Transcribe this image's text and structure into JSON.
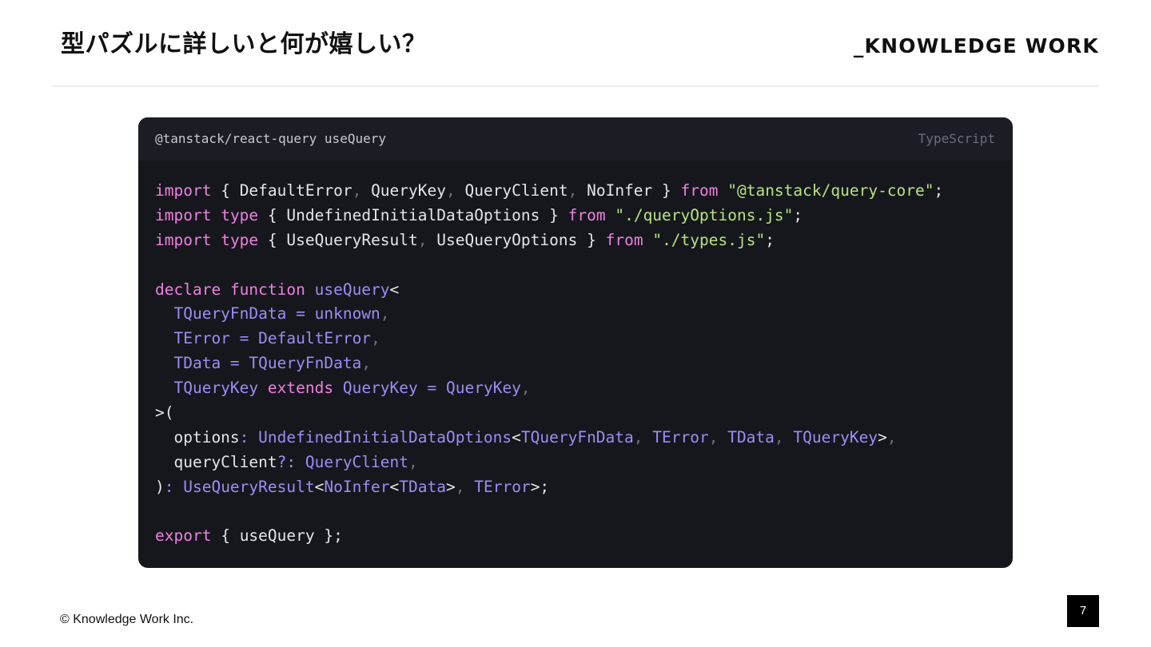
{
  "slide": {
    "title": "型パズルに詳しいと何が嬉しい？",
    "brand": "_KNOWLEDGE WORK",
    "copyright": "© Knowledge Work Inc.",
    "page_number": "7"
  },
  "code_block": {
    "file_title": "@tanstack/react-query useQuery",
    "language": "TypeScript",
    "colors": {
      "background": "#16171d",
      "header_background": "#1c1d24",
      "keyword": "#ef7fe1",
      "string": "#b7e37e",
      "type": "#9e8cf5",
      "identifier": "#e4e5ea",
      "comma": "#6d6f7c"
    },
    "lines": [
      [
        {
          "t": "import",
          "k": "kw"
        },
        {
          "t": " { ",
          "k": "punc"
        },
        {
          "t": "DefaultError",
          "k": "id"
        },
        {
          "t": ", ",
          "k": "dim"
        },
        {
          "t": "QueryKey",
          "k": "id"
        },
        {
          "t": ", ",
          "k": "dim"
        },
        {
          "t": "QueryClient",
          "k": "id"
        },
        {
          "t": ", ",
          "k": "dim"
        },
        {
          "t": "NoInfer",
          "k": "id"
        },
        {
          "t": " } ",
          "k": "punc"
        },
        {
          "t": "from",
          "k": "kw"
        },
        {
          "t": " ",
          "k": "punc"
        },
        {
          "t": "\"@tanstack/query-core\"",
          "k": "str"
        },
        {
          "t": ";",
          "k": "punc"
        }
      ],
      [
        {
          "t": "import",
          "k": "kw"
        },
        {
          "t": " ",
          "k": "punc"
        },
        {
          "t": "type",
          "k": "kw"
        },
        {
          "t": " { ",
          "k": "punc"
        },
        {
          "t": "UndefinedInitialDataOptions",
          "k": "id"
        },
        {
          "t": " } ",
          "k": "punc"
        },
        {
          "t": "from",
          "k": "kw"
        },
        {
          "t": " ",
          "k": "punc"
        },
        {
          "t": "\"./queryOptions.js\"",
          "k": "str"
        },
        {
          "t": ";",
          "k": "punc"
        }
      ],
      [
        {
          "t": "import",
          "k": "kw"
        },
        {
          "t": " ",
          "k": "punc"
        },
        {
          "t": "type",
          "k": "kw"
        },
        {
          "t": " { ",
          "k": "punc"
        },
        {
          "t": "UseQueryResult",
          "k": "id"
        },
        {
          "t": ", ",
          "k": "dim"
        },
        {
          "t": "UseQueryOptions",
          "k": "id"
        },
        {
          "t": " } ",
          "k": "punc"
        },
        {
          "t": "from",
          "k": "kw"
        },
        {
          "t": " ",
          "k": "punc"
        },
        {
          "t": "\"./types.js\"",
          "k": "str"
        },
        {
          "t": ";",
          "k": "punc"
        }
      ],
      [],
      [
        {
          "t": "declare",
          "k": "kw"
        },
        {
          "t": " ",
          "k": "punc"
        },
        {
          "t": "function",
          "k": "kw"
        },
        {
          "t": " ",
          "k": "punc"
        },
        {
          "t": "useQuery",
          "k": "type"
        },
        {
          "t": "<",
          "k": "punc"
        }
      ],
      [
        {
          "t": "  ",
          "k": "punc"
        },
        {
          "t": "TQueryFnData",
          "k": "type"
        },
        {
          "t": " = ",
          "k": "type"
        },
        {
          "t": "unknown",
          "k": "type"
        },
        {
          "t": ",",
          "k": "dim"
        }
      ],
      [
        {
          "t": "  ",
          "k": "punc"
        },
        {
          "t": "TError",
          "k": "type"
        },
        {
          "t": " = ",
          "k": "type"
        },
        {
          "t": "DefaultError",
          "k": "type"
        },
        {
          "t": ",",
          "k": "dim"
        }
      ],
      [
        {
          "t": "  ",
          "k": "punc"
        },
        {
          "t": "TData",
          "k": "type"
        },
        {
          "t": " = ",
          "k": "type"
        },
        {
          "t": "TQueryFnData",
          "k": "type"
        },
        {
          "t": ",",
          "k": "dim"
        }
      ],
      [
        {
          "t": "  ",
          "k": "punc"
        },
        {
          "t": "TQueryKey",
          "k": "type"
        },
        {
          "t": " ",
          "k": "punc"
        },
        {
          "t": "extends",
          "k": "kw"
        },
        {
          "t": " ",
          "k": "punc"
        },
        {
          "t": "QueryKey",
          "k": "type"
        },
        {
          "t": " = ",
          "k": "type"
        },
        {
          "t": "QueryKey",
          "k": "type"
        },
        {
          "t": ",",
          "k": "dim"
        }
      ],
      [
        {
          "t": ">(",
          "k": "punc"
        }
      ],
      [
        {
          "t": "  ",
          "k": "punc"
        },
        {
          "t": "options",
          "k": "id"
        },
        {
          "t": ": ",
          "k": "type"
        },
        {
          "t": "UndefinedInitialDataOptions",
          "k": "type"
        },
        {
          "t": "<",
          "k": "punc"
        },
        {
          "t": "TQueryFnData",
          "k": "type"
        },
        {
          "t": ", ",
          "k": "dim"
        },
        {
          "t": "TError",
          "k": "type"
        },
        {
          "t": ", ",
          "k": "dim"
        },
        {
          "t": "TData",
          "k": "type"
        },
        {
          "t": ", ",
          "k": "dim"
        },
        {
          "t": "TQueryKey",
          "k": "type"
        },
        {
          "t": ">",
          "k": "punc"
        },
        {
          "t": ",",
          "k": "dim"
        }
      ],
      [
        {
          "t": "  ",
          "k": "punc"
        },
        {
          "t": "queryClient",
          "k": "id"
        },
        {
          "t": "?: ",
          "k": "type"
        },
        {
          "t": "QueryClient",
          "k": "type"
        },
        {
          "t": ",",
          "k": "dim"
        }
      ],
      [
        {
          "t": ")",
          "k": "punc"
        },
        {
          "t": ": ",
          "k": "type"
        },
        {
          "t": "UseQueryResult",
          "k": "type"
        },
        {
          "t": "<",
          "k": "punc"
        },
        {
          "t": "NoInfer",
          "k": "type"
        },
        {
          "t": "<",
          "k": "punc"
        },
        {
          "t": "TData",
          "k": "type"
        },
        {
          "t": ">",
          "k": "punc"
        },
        {
          "t": ", ",
          "k": "dim"
        },
        {
          "t": "TError",
          "k": "type"
        },
        {
          "t": ">;",
          "k": "punc"
        }
      ],
      [],
      [
        {
          "t": "export",
          "k": "kw"
        },
        {
          "t": " { ",
          "k": "punc"
        },
        {
          "t": "useQuery",
          "k": "id"
        },
        {
          "t": " };",
          "k": "punc"
        }
      ]
    ]
  }
}
